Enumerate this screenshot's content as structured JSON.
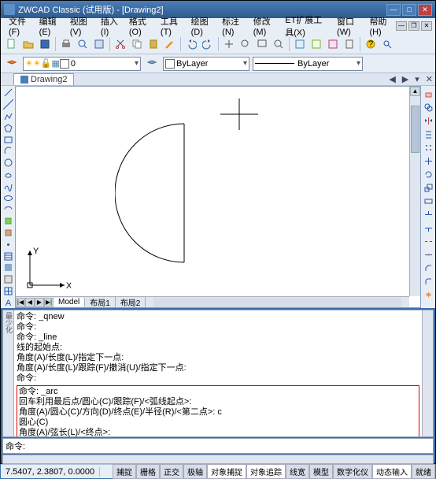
{
  "title": "ZWCAD Classic (试用版) - [Drawing2]",
  "menu": [
    "文件(F)",
    "编辑(E)",
    "视图(V)",
    "插入(I)",
    "格式(O)",
    "工具(T)",
    "绘图(D)",
    "标注(N)",
    "修改(M)",
    "ET扩展工具(X)",
    "窗口(W)",
    "帮助(H)"
  ],
  "doc_tab": "Drawing2",
  "layer_dd": "0",
  "color_dd": "ByLayer",
  "ltype_dd": "ByLayer",
  "model_tabs": {
    "nav": [
      "|◀",
      "◀",
      "▶",
      "▶|"
    ],
    "tabs": [
      "Model",
      "布局1",
      "布局2"
    ]
  },
  "cmd_history": [
    "命令: _qnew",
    "命令:",
    "命令: _line",
    "线的起始点:",
    "角度(A)/长度(L)/指定下一点:",
    "角度(A)/长度(L)/跟踪(F)/撤消(U)/指定下一点:",
    "命令:"
  ],
  "cmd_redbox": [
    "命令: _arc",
    "回车利用最后点/圆心(C)/跟踪(F)/<弧线起点>:",
    "角度(A)/圆心(C)/方向(D)/终点(E)/半径(R)/<第二点>: c",
    "圆心(C)",
    "角度(A)/弦长(L)/<终点>:"
  ],
  "cmd_side": "最少化",
  "cmd_prompt": "命令:",
  "coords": "7.5407, 2.3807, 0.0000",
  "status_btns": [
    "捕捉",
    "栅格",
    "正交",
    "极轴",
    "对象捕捉",
    "对象追踪",
    "线宽",
    "模型",
    "数字化仪",
    "动态输入",
    "就绪"
  ],
  "status_on": [
    4,
    5,
    9
  ],
  "ucs": {
    "x": "X",
    "y": "Y"
  }
}
